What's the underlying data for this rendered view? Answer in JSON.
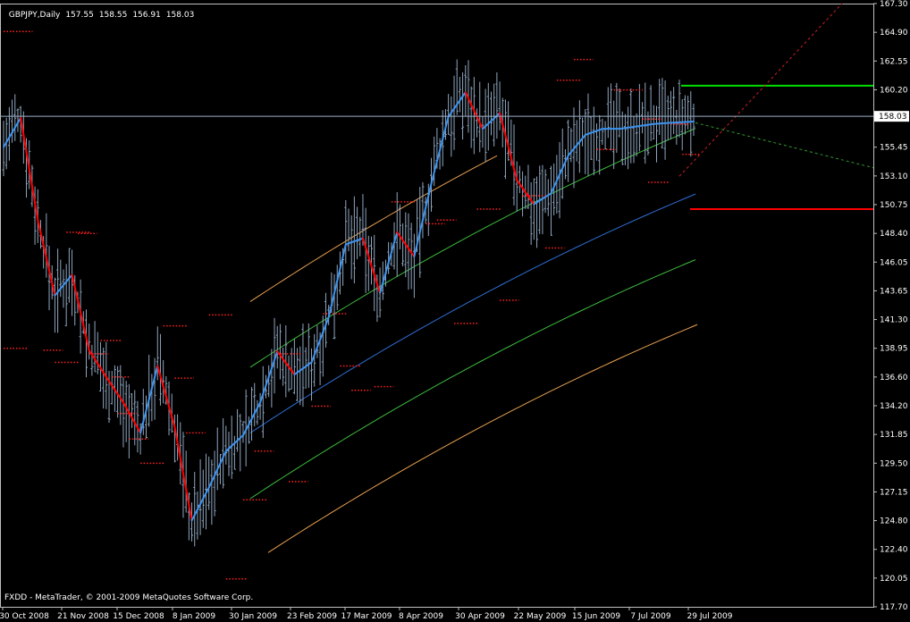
{
  "header": {
    "symbol_timeframe": "GBPJPY,Daily",
    "open": "157.55",
    "high": "158.55",
    "low": "156.91",
    "close": "158.03"
  },
  "footer": {
    "copyright": "FXDD - MetaTrader, © 2001-2009 MetaQuotes Software Corp."
  },
  "chart_data": {
    "type": "ohlc",
    "title": "GBPJPY,Daily",
    "last_price": 158.03,
    "last_price_label": "158.03",
    "ylim": [
      117.7,
      167.3
    ],
    "y_ticks": [
      "167.30",
      "164.90",
      "162.55",
      "160.20",
      "157.85",
      "155.45",
      "153.10",
      "150.75",
      "148.40",
      "146.05",
      "143.65",
      "141.30",
      "138.95",
      "136.60",
      "134.20",
      "131.85",
      "129.50",
      "127.15",
      "124.80",
      "122.40",
      "120.05",
      "117.70"
    ],
    "x_ticks": [
      "30 Oct 2008",
      "21 Nov 2008",
      "15 Dec 2008",
      "8 Jan 2009",
      "30 Jan 2009",
      "23 Feb 2009",
      "17 Mar 2009",
      "8 Apr 2009",
      "30 Apr 2009",
      "22 May 2009",
      "15 Jun 2009",
      "7 Jul 2009",
      "29 Jul 2009"
    ],
    "grid": false,
    "colors": {
      "background": "#000000",
      "axis": "#c0c0c0",
      "bars": "#8fa6bf",
      "ma_up": "#3d93ee",
      "ma_down": "#ff0000",
      "fractal_dots": "#ff2020",
      "regression": "#2f6fd6",
      "inner_channel": "#3dbb3d",
      "outer_channel": "#e8a050",
      "resistance": "#00e000",
      "support": "#ff0000",
      "price_line": "#9bb0c8",
      "trend_up": "#cc2020",
      "trend_down": "#2f9a2f"
    },
    "levels": {
      "resistance": 160.55,
      "support": 150.4
    },
    "series": [
      {
        "name": "ma_smoothed",
        "bar_index": [
          0,
          6,
          12,
          18,
          24,
          30,
          36,
          42,
          48,
          54,
          60,
          66,
          72,
          78,
          84,
          90,
          96,
          102,
          108,
          114,
          120,
          126,
          132,
          138,
          144,
          150,
          156,
          162,
          168,
          174,
          180,
          186,
          192,
          198,
          204,
          210,
          216,
          222,
          228,
          234,
          242
        ],
        "values": [
          155.5,
          157.9,
          149.5,
          143.3,
          145.0,
          138.8,
          136.6,
          134.5,
          132.0,
          137.5,
          132.5,
          124.8,
          127.5,
          130.5,
          131.8,
          134.5,
          138.7,
          136.8,
          137.8,
          141.5,
          147.5,
          148.0,
          143.5,
          148.5,
          146.5,
          152.5,
          158.0,
          160.0,
          157.0,
          158.3,
          152.8,
          150.8,
          151.7,
          154.8,
          156.5,
          157.0,
          157.0,
          157.2,
          157.4,
          157.5,
          157.6
        ]
      }
    ]
  }
}
